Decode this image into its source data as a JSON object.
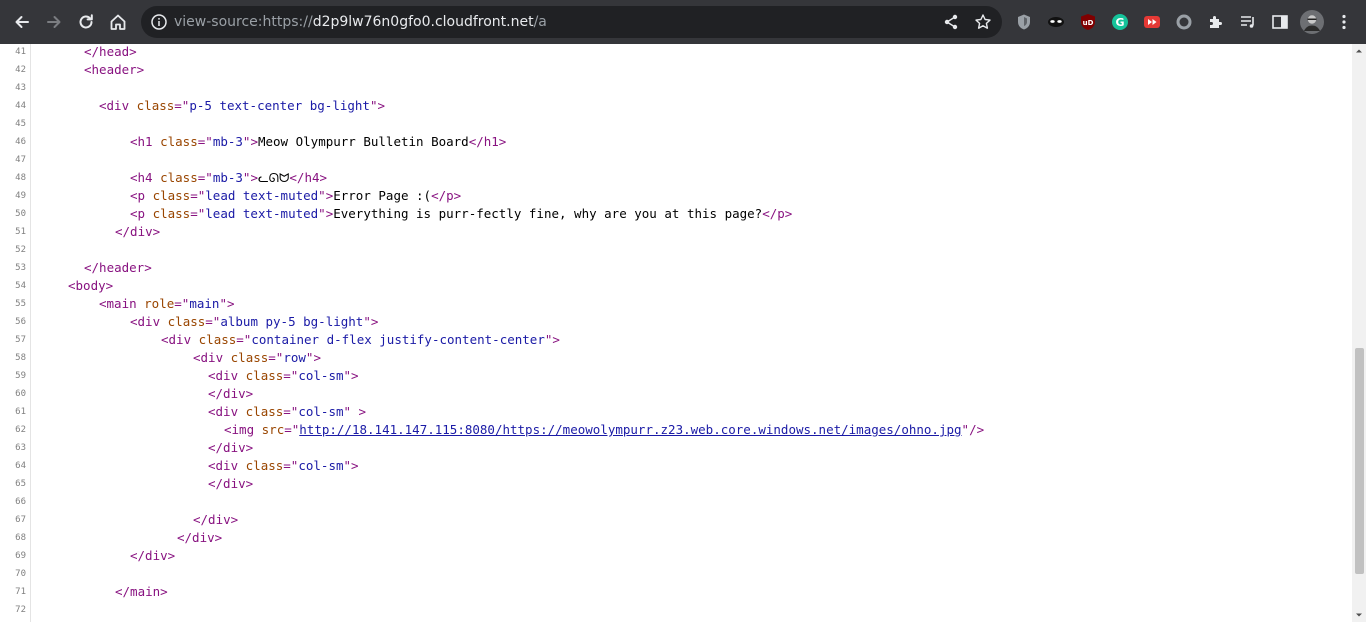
{
  "browser": {
    "url_scheme": "view-source:https://",
    "url_host": "d2p9lw76n0gfo0.cloudfront.net",
    "url_path": "/a"
  },
  "colors": {
    "toolbar_bg": "#35363a",
    "omnibox_bg": "#202124",
    "tag": "#881280",
    "attr_name": "#994500",
    "attr_value": "#1a1aa6"
  },
  "extensions": [
    "shield-extension-icon",
    "mask-extension-icon",
    "ublock-origin-icon",
    "grammarly-icon",
    "video-speed-icon",
    "circle-extension-icon",
    "puzzle-extensions-icon",
    "reading-list-icon",
    "side-panel-icon",
    "profile-avatar",
    "kebab-menu-icon"
  ],
  "source": {
    "lines": [
      {
        "n": "41",
        "segs": [
          {
            "c": "t",
            "t": "</head>"
          }
        ]
      },
      {
        "n": "42",
        "segs": [
          {
            "c": "t",
            "t": "<header>"
          }
        ]
      },
      {
        "n": "43",
        "segs": []
      },
      {
        "n": "44",
        "segs": [
          {
            "c": "t",
            "t": "<div "
          },
          {
            "c": "a",
            "t": "class"
          },
          {
            "c": "t",
            "t": "=\""
          },
          {
            "c": "v",
            "t": "p-5 text-center bg-light"
          },
          {
            "c": "t",
            "t": "\">"
          }
        ]
      },
      {
        "n": "45",
        "segs": []
      },
      {
        "n": "46",
        "segs": [
          {
            "c": "t",
            "t": "<h1 "
          },
          {
            "c": "a",
            "t": "class"
          },
          {
            "c": "t",
            "t": "=\""
          },
          {
            "c": "v",
            "t": "mb-3"
          },
          {
            "c": "t",
            "t": "\">"
          },
          {
            "c": "x",
            "t": "Meow Olympurr Bulletin Board"
          },
          {
            "c": "t",
            "t": "</h1>"
          }
        ]
      },
      {
        "n": "47",
        "segs": []
      },
      {
        "n": "48",
        "segs": [
          {
            "c": "t",
            "t": "<h4 "
          },
          {
            "c": "a",
            "t": "class"
          },
          {
            "c": "t",
            "t": "=\""
          },
          {
            "c": "v",
            "t": "mb-3"
          },
          {
            "c": "t",
            "t": "\">"
          },
          {
            "c": "x",
            "t": "ᓚᘏᗢ"
          },
          {
            "c": "t",
            "t": "</h4>"
          }
        ]
      },
      {
        "n": "49",
        "segs": [
          {
            "c": "t",
            "t": "<p "
          },
          {
            "c": "a",
            "t": "class"
          },
          {
            "c": "t",
            "t": "=\""
          },
          {
            "c": "v",
            "t": "lead text-muted"
          },
          {
            "c": "t",
            "t": "\">"
          },
          {
            "c": "x",
            "t": "Error Page :("
          },
          {
            "c": "t",
            "t": "</p>"
          }
        ]
      },
      {
        "n": "50",
        "segs": [
          {
            "c": "t",
            "t": "<p "
          },
          {
            "c": "a",
            "t": "class"
          },
          {
            "c": "t",
            "t": "=\""
          },
          {
            "c": "v",
            "t": "lead text-muted"
          },
          {
            "c": "t",
            "t": "\">"
          },
          {
            "c": "x",
            "t": "Everything is purr-fectly fine, why are you at this page?"
          },
          {
            "c": "t",
            "t": "</p>"
          }
        ]
      },
      {
        "n": "51",
        "segs": [
          {
            "c": "t",
            "t": "</div>"
          }
        ]
      },
      {
        "n": "52",
        "segs": []
      },
      {
        "n": "53",
        "segs": [
          {
            "c": "t",
            "t": "</header>"
          }
        ]
      },
      {
        "n": "54",
        "segs": [
          {
            "c": "t",
            "t": "<body>"
          }
        ]
      },
      {
        "n": "55",
        "segs": [
          {
            "c": "t",
            "t": "<main "
          },
          {
            "c": "a",
            "t": "role"
          },
          {
            "c": "t",
            "t": "=\""
          },
          {
            "c": "v",
            "t": "main"
          },
          {
            "c": "t",
            "t": "\">"
          }
        ]
      },
      {
        "n": "56",
        "segs": [
          {
            "c": "t",
            "t": "<div "
          },
          {
            "c": "a",
            "t": "class"
          },
          {
            "c": "t",
            "t": "=\""
          },
          {
            "c": "v",
            "t": "album py-5 bg-light"
          },
          {
            "c": "t",
            "t": "\">"
          }
        ]
      },
      {
        "n": "57",
        "segs": [
          {
            "c": "t",
            "t": "<div "
          },
          {
            "c": "a",
            "t": "class"
          },
          {
            "c": "t",
            "t": "=\""
          },
          {
            "c": "v",
            "t": "container d-flex justify-content-center"
          },
          {
            "c": "t",
            "t": "\">"
          }
        ]
      },
      {
        "n": "58",
        "segs": [
          {
            "c": "t",
            "t": "<div "
          },
          {
            "c": "a",
            "t": "class"
          },
          {
            "c": "t",
            "t": "=\""
          },
          {
            "c": "v",
            "t": "row"
          },
          {
            "c": "t",
            "t": "\">"
          }
        ]
      },
      {
        "n": "59",
        "segs": [
          {
            "c": "t",
            "t": "<div "
          },
          {
            "c": "a",
            "t": "class"
          },
          {
            "c": "t",
            "t": "=\""
          },
          {
            "c": "v",
            "t": "col-sm"
          },
          {
            "c": "t",
            "t": "\">"
          }
        ]
      },
      {
        "n": "60",
        "segs": [
          {
            "c": "t",
            "t": "</div>"
          }
        ]
      },
      {
        "n": "61",
        "segs": [
          {
            "c": "t",
            "t": "<div "
          },
          {
            "c": "a",
            "t": "class"
          },
          {
            "c": "t",
            "t": "=\""
          },
          {
            "c": "v",
            "t": "col-sm"
          },
          {
            "c": "t",
            "t": "\" >"
          }
        ]
      },
      {
        "n": "62",
        "segs": [
          {
            "c": "t",
            "t": "<img "
          },
          {
            "c": "a",
            "t": "src"
          },
          {
            "c": "t",
            "t": "=\""
          },
          {
            "c": "lk",
            "t": "http://18.141.147.115:8080/https://meowolympurr.z23.web.core.windows.net/images/ohno.jpg"
          },
          {
            "c": "t",
            "t": "\"/>"
          }
        ]
      },
      {
        "n": "63",
        "segs": [
          {
            "c": "t",
            "t": "</div>"
          }
        ]
      },
      {
        "n": "64",
        "segs": [
          {
            "c": "t",
            "t": "<div "
          },
          {
            "c": "a",
            "t": "class"
          },
          {
            "c": "t",
            "t": "=\""
          },
          {
            "c": "v",
            "t": "col-sm"
          },
          {
            "c": "t",
            "t": "\">"
          }
        ]
      },
      {
        "n": "65",
        "segs": [
          {
            "c": "t",
            "t": "</div>"
          }
        ]
      },
      {
        "n": "66",
        "segs": []
      },
      {
        "n": "67",
        "segs": [
          {
            "c": "t",
            "t": "</div>"
          }
        ]
      },
      {
        "n": "68",
        "segs": [
          {
            "c": "t",
            "t": "</div>"
          }
        ]
      },
      {
        "n": "69",
        "segs": [
          {
            "c": "t",
            "t": "</div>"
          }
        ]
      },
      {
        "n": "70",
        "segs": []
      },
      {
        "n": "71",
        "segs": [
          {
            "c": "t",
            "t": "</main>"
          }
        ]
      },
      {
        "n": "72",
        "segs": []
      }
    ]
  }
}
